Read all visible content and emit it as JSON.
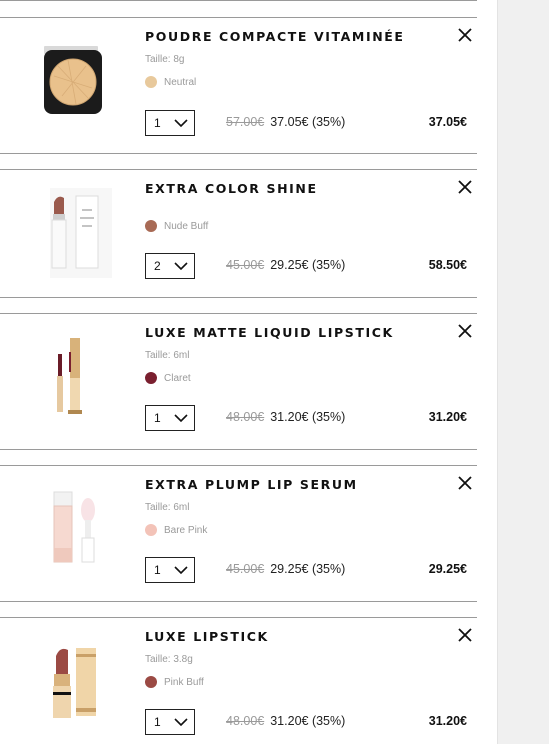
{
  "cart": {
    "items": [
      {
        "name": "POUDRE COMPACTE VITAMINÉE",
        "size": "Taille: 8g",
        "shade": "Neutral",
        "shade_color": "#e8c99c",
        "qty": "1",
        "old_price": "57.00€",
        "price": "37.05€ (35%)",
        "total": "37.05€",
        "image_icon": "compact-powder-icon"
      },
      {
        "name": "EXTRA COLOR SHINE",
        "size": "",
        "shade": "Nude Buff",
        "shade_color": "#a86a55",
        "qty": "2",
        "old_price": "45.00€",
        "price": "29.25€ (35%)",
        "total": "58.50€",
        "image_icon": "lipstick-tube-icon"
      },
      {
        "name": "LUXE MATTE LIQUID LIPSTICK",
        "size": "Taille: 6ml",
        "shade": "Claret",
        "shade_color": "#7a1f2f",
        "qty": "1",
        "old_price": "48.00€",
        "price": "31.20€ (35%)",
        "total": "31.20€",
        "image_icon": "liquid-lipstick-icon"
      },
      {
        "name": "EXTRA PLUMP LIP SERUM",
        "size": "Taille: 6ml",
        "shade": "Bare Pink",
        "shade_color": "#f3c3b8",
        "qty": "1",
        "old_price": "45.00€",
        "price": "29.25€ (35%)",
        "total": "29.25€",
        "image_icon": "lip-serum-icon"
      },
      {
        "name": "LUXE LIPSTICK",
        "size": "Taille: 3.8g",
        "shade": "Pink Buff",
        "shade_color": "#9b4a44",
        "qty": "1",
        "old_price": "48.00€",
        "price": "31.20€ (35%)",
        "total": "31.20€",
        "image_icon": "luxe-lipstick-icon"
      }
    ],
    "remove_icon": "close-icon",
    "qty_icon": "chevron-down-icon"
  }
}
